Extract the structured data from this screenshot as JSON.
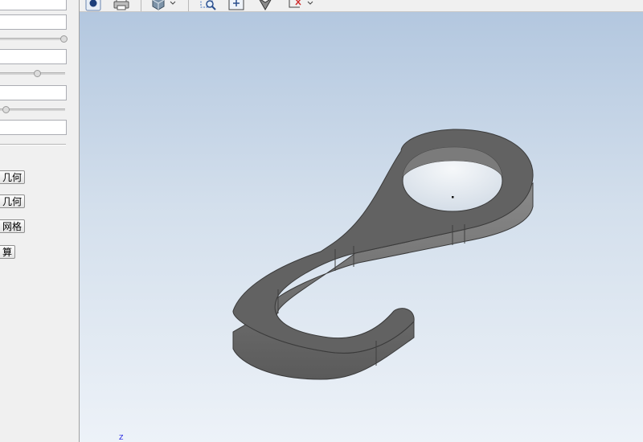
{
  "left_panel": {
    "buttons": [
      {
        "label": "几何"
      },
      {
        "label": "几何"
      },
      {
        "label": "网格"
      },
      {
        "label": "算"
      }
    ],
    "sliders": [
      {
        "value": 0.98
      },
      {
        "value": 0.57
      },
      {
        "value": 0.09
      }
    ]
  },
  "toolbar": {
    "icons": [
      "record-icon",
      "print-icon",
      "shading-icon",
      "zoom-window-icon",
      "fit-all-icon",
      "view-orientation-icon",
      "axis-x-icon"
    ]
  },
  "viewport": {
    "axis_label": "Z",
    "colors": {
      "bg_top": "#b3c7df",
      "bg_bottom": "#edf2f8",
      "model": "#5b5b5b",
      "model_top": "#636363",
      "model_side": "#7a7a7a"
    }
  }
}
